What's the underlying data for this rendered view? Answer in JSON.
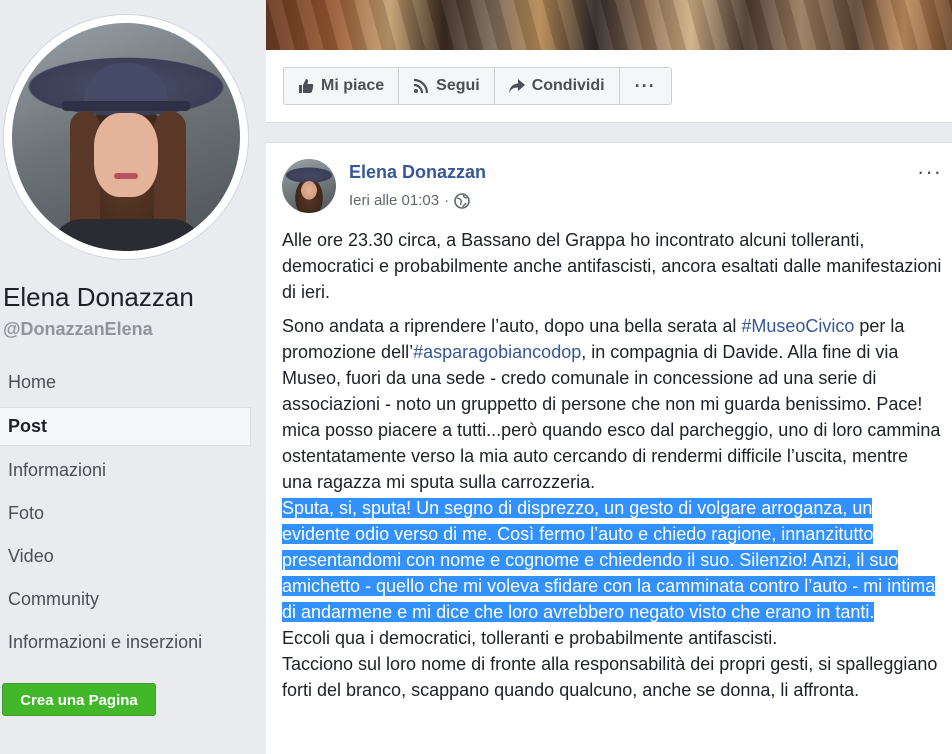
{
  "profile": {
    "name": "Elena Donazzan",
    "handle": "@DonazzanElena"
  },
  "nav": {
    "items": [
      {
        "label": "Home"
      },
      {
        "label": "Post"
      },
      {
        "label": "Informazioni"
      },
      {
        "label": "Foto"
      },
      {
        "label": "Video"
      },
      {
        "label": "Community"
      },
      {
        "label": "Informazioni e inserzioni"
      }
    ],
    "active": "Post"
  },
  "create_page_label": "Crea una Pagina",
  "actions": {
    "like": "Mi piace",
    "follow": "Segui",
    "share": "Condividi",
    "more": "···"
  },
  "post": {
    "author": "Elena Donazzan",
    "time": "Ieri alle 01:03",
    "separator": "·",
    "options": "···",
    "p1": "Alle ore 23.30 circa, a Bassano del Grappa ho incontrato alcuni tolleranti, democratici e probabilmente anche antifascisti, ancora esaltati dalle manifestazioni di ieri.",
    "p2_a": "Sono andata a riprendere l’auto, dopo una bella serata al ",
    "hashtag1": "#MuseoCivico",
    "p2_b": " per la promozione dell’",
    "hashtag2": "#asparagobiancodop",
    "p2_c": ", in compagnia di Davide. Alla fine di via Museo, fuori da una sede - credo comunale in concessione ad una serie di associazioni - noto un gruppetto di persone che non mi guarda benissimo. Pace! mica posso piacere a tutti...però quando esco dal parcheggio, uno di loro cammina ostentatamente verso la mia auto cercando di rendermi difficile l’uscita, mentre una ragazza mi sputa sulla carrozzeria.",
    "highlighted": "Sputa, si, sputa! Un segno di disprezzo, un gesto di volgare arroganza, un evidente odio verso di me. Così fermo l’auto e chiedo ragione, innanzitutto presentandomi con nome e cognome e chiedendo il suo. Silenzio! Anzi, il suo amichetto - quello che mi voleva sfidare con la camminata contro l’auto - mi intima di andarmene e mi dice che loro avrebbero negato visto che erano in tanti.",
    "p3": "Eccoli qua i democratici, tolleranti e probabilmente antifascisti.",
    "p4": "Tacciono sul loro nome di fronte alla responsabilità dei propri gesti, si spalleggiano forti del branco, scappano quando qualcuno, anche se donna, li affronta."
  },
  "colors": {
    "link": "#365899",
    "highlight": "#3390ff",
    "create_button": "#42b72a",
    "background": "#e9ebee"
  },
  "icons": {
    "like": "thumbs-up-icon",
    "follow": "rss-icon",
    "share": "share-arrow-icon",
    "privacy": "globe-icon"
  }
}
